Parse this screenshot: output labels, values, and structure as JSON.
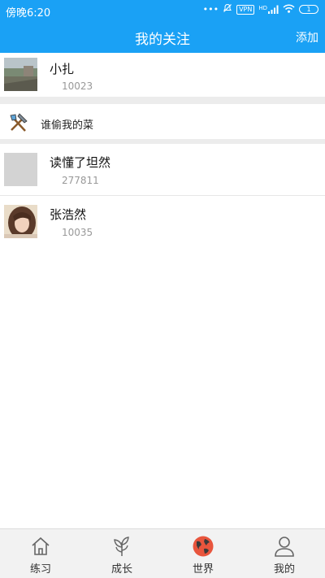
{
  "status_bar": {
    "time": "傍晚6:20",
    "dots": "•••",
    "vpn": "VPN",
    "hd": "HD",
    "battery": "1"
  },
  "header": {
    "title": "我的关注",
    "add_label": "添加"
  },
  "following": [
    {
      "name": "小扎",
      "id": "10023"
    },
    {
      "name": "读懂了坦然",
      "id": "277811"
    },
    {
      "name": "张浩然",
      "id": "10035"
    }
  ],
  "feature": {
    "label": "谁偷我的菜",
    "icon": "tools-icon"
  },
  "tabs": [
    {
      "label": "练习",
      "icon": "house-icon"
    },
    {
      "label": "成长",
      "icon": "sprout-icon"
    },
    {
      "label": "世界",
      "icon": "globe-icon"
    },
    {
      "label": "我的",
      "icon": "person-icon"
    }
  ],
  "colors": {
    "accent": "#1aa1f5",
    "globe": "#e8553d"
  }
}
